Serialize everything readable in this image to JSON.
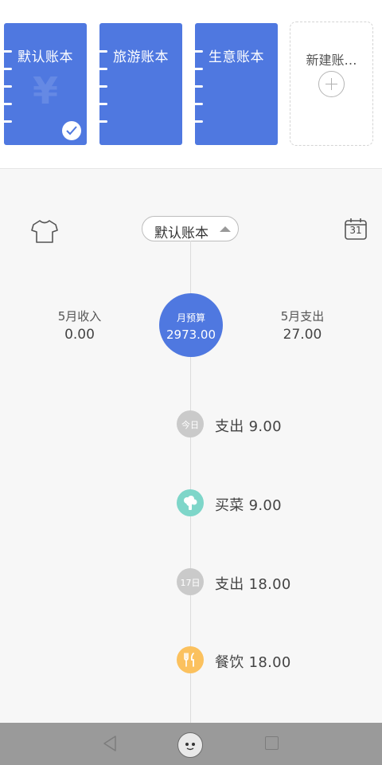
{
  "books": {
    "items": [
      {
        "title": "默认账本",
        "selected": true
      },
      {
        "title": "旅游账本",
        "selected": false
      },
      {
        "title": "生意账本",
        "selected": false
      }
    ],
    "yen_symbol": "¥",
    "new_book_label": "新建账…"
  },
  "header": {
    "selected_book": "默认账本",
    "calendar_day": "31"
  },
  "summary": {
    "income_label": "5月收入",
    "income_value": "0.00",
    "budget_label": "月预算",
    "budget_value": "2973.00",
    "expense_label": "5月支出",
    "expense_value": "27.00"
  },
  "timeline": [
    {
      "type": "date",
      "badge": "今日",
      "text": "支出 9.00"
    },
    {
      "type": "entry",
      "icon": "vegetable-icon",
      "text": "买菜 9.00"
    },
    {
      "type": "date",
      "badge": "17日",
      "text": "支出 18.00"
    },
    {
      "type": "entry",
      "icon": "fork-knife-icon",
      "text": "餐饮 18.00"
    }
  ],
  "colors": {
    "accent": "#4f78e0",
    "teal": "#7ed6c9",
    "yellow": "#fbc15e",
    "badge_gray": "#cacaca"
  }
}
